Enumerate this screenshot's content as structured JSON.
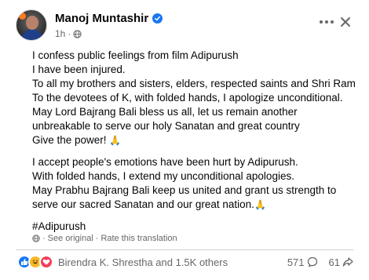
{
  "post": {
    "author": "Manoj Muntashir",
    "verified": true,
    "time": "1h",
    "audience_icon": "globe-icon",
    "body": {
      "para1": [
        "I confess public feelings from film Adipurush",
        "I have been injured.",
        "To all my brothers and sisters, elders, respected saints and Shri Ram",
        "To the devotees of K, with folded hands, I apologize unconditional.",
        "May Lord Bajrang Bali bless us all, let us remain another",
        "unbreakable to serve our holy Sanatan and great country",
        "Give the power!"
      ],
      "para2": [
        "I accept people's emotions have been hurt by Adipurush.",
        "With folded hands, I extend my unconditional apologies.",
        "May Prabhu Bajrang Bali keep us united and grant us strength to",
        "serve our sacred Sanatan and our great nation."
      ],
      "hashtag": "#Adipurush",
      "pray_emoji": "🙏"
    },
    "translation": {
      "see_original": "See original",
      "separator": "·",
      "rate": "Rate this translation"
    },
    "stats": {
      "reactors": "Birendra K. Shrestha and 1.5K others",
      "comments": "571",
      "shares": "61"
    }
  },
  "colors": {
    "accent": "#1877f2",
    "text": "#050505",
    "secondary": "#65676b"
  }
}
